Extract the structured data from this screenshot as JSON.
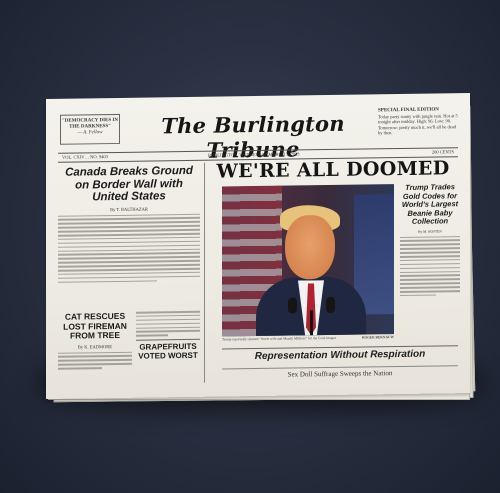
{
  "newspaper": {
    "masthead_quote": "\"DEMOCRACY DIES IN THE DARKNESS\"",
    "masthead_quote_author": "— A. Fellow",
    "title": "The Burlington Tribune",
    "special_label": "SPECIAL FINAL EDITION",
    "special_text": "Today party sunny with jungle rain. Hot at 5 tonight after midday. High: 96. Low: 90. Tomorrow: pretty much it, we'll all be dead by then.",
    "vol": "VOL. CXIV… NO. 9403",
    "date": "BURLINGTON, WEDNESDAY MARCH 3, 2023",
    "price": "200 CENTS",
    "main_headline": "WE'RE ALL DOOMED",
    "left_headline": "Canada Breaks Ground on Border Wall with United States",
    "left_byline": "By T. BALTHAZAR",
    "right_headline": "Trump Trades Gold Codes for World's Largest Beanie Baby Collection",
    "right_byline": "By M. HOSTEN",
    "photo_caption": "Trump reportedly shouted \"Sweet wife and Mandy Million!\" for the Gosh images",
    "photo_credit": "ROGER BEKNAUW",
    "secondary_headline": "Representation Without Respiration",
    "footline": "Sex Doll Suffrage Sweeps the Nation",
    "cat_headline": "CAT RESCUES LOST FIREMAN FROM TREE",
    "cat_byline": "By K. EADMORE",
    "grape_headline": "GRAPEFRUITS VOTED WORST"
  }
}
